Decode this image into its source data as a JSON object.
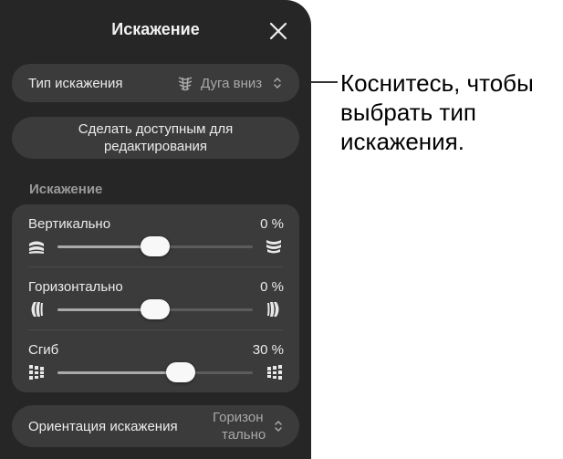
{
  "panel": {
    "title": "Искажение"
  },
  "warp_type": {
    "label": "Тип искажения",
    "value": "Дуга вниз",
    "icon": "arc-down-warp-icon"
  },
  "editable_button": {
    "label_line1": "Сделать доступным для",
    "label_line2": "редактирования"
  },
  "section": {
    "header": "Искажение"
  },
  "sliders": [
    {
      "label": "Вертикально",
      "value_text": "0 %",
      "level": 0.5
    },
    {
      "label": "Горизонтально",
      "value_text": "0 %",
      "level": 0.5
    },
    {
      "label": "Сгиб",
      "value_text": "30 %",
      "level": 0.65
    }
  ],
  "orientation": {
    "label": "Ориентация искажения",
    "value_line1": "Горизон",
    "value_line2": "тально"
  },
  "callout": {
    "line1": "Коснитесь, чтобы",
    "line2": "выбрать тип",
    "line3": "искажения."
  },
  "colors": {
    "panel_bg": "#262626",
    "control_bg": "#3b3b3b",
    "thumb": "#f8f8f8"
  }
}
